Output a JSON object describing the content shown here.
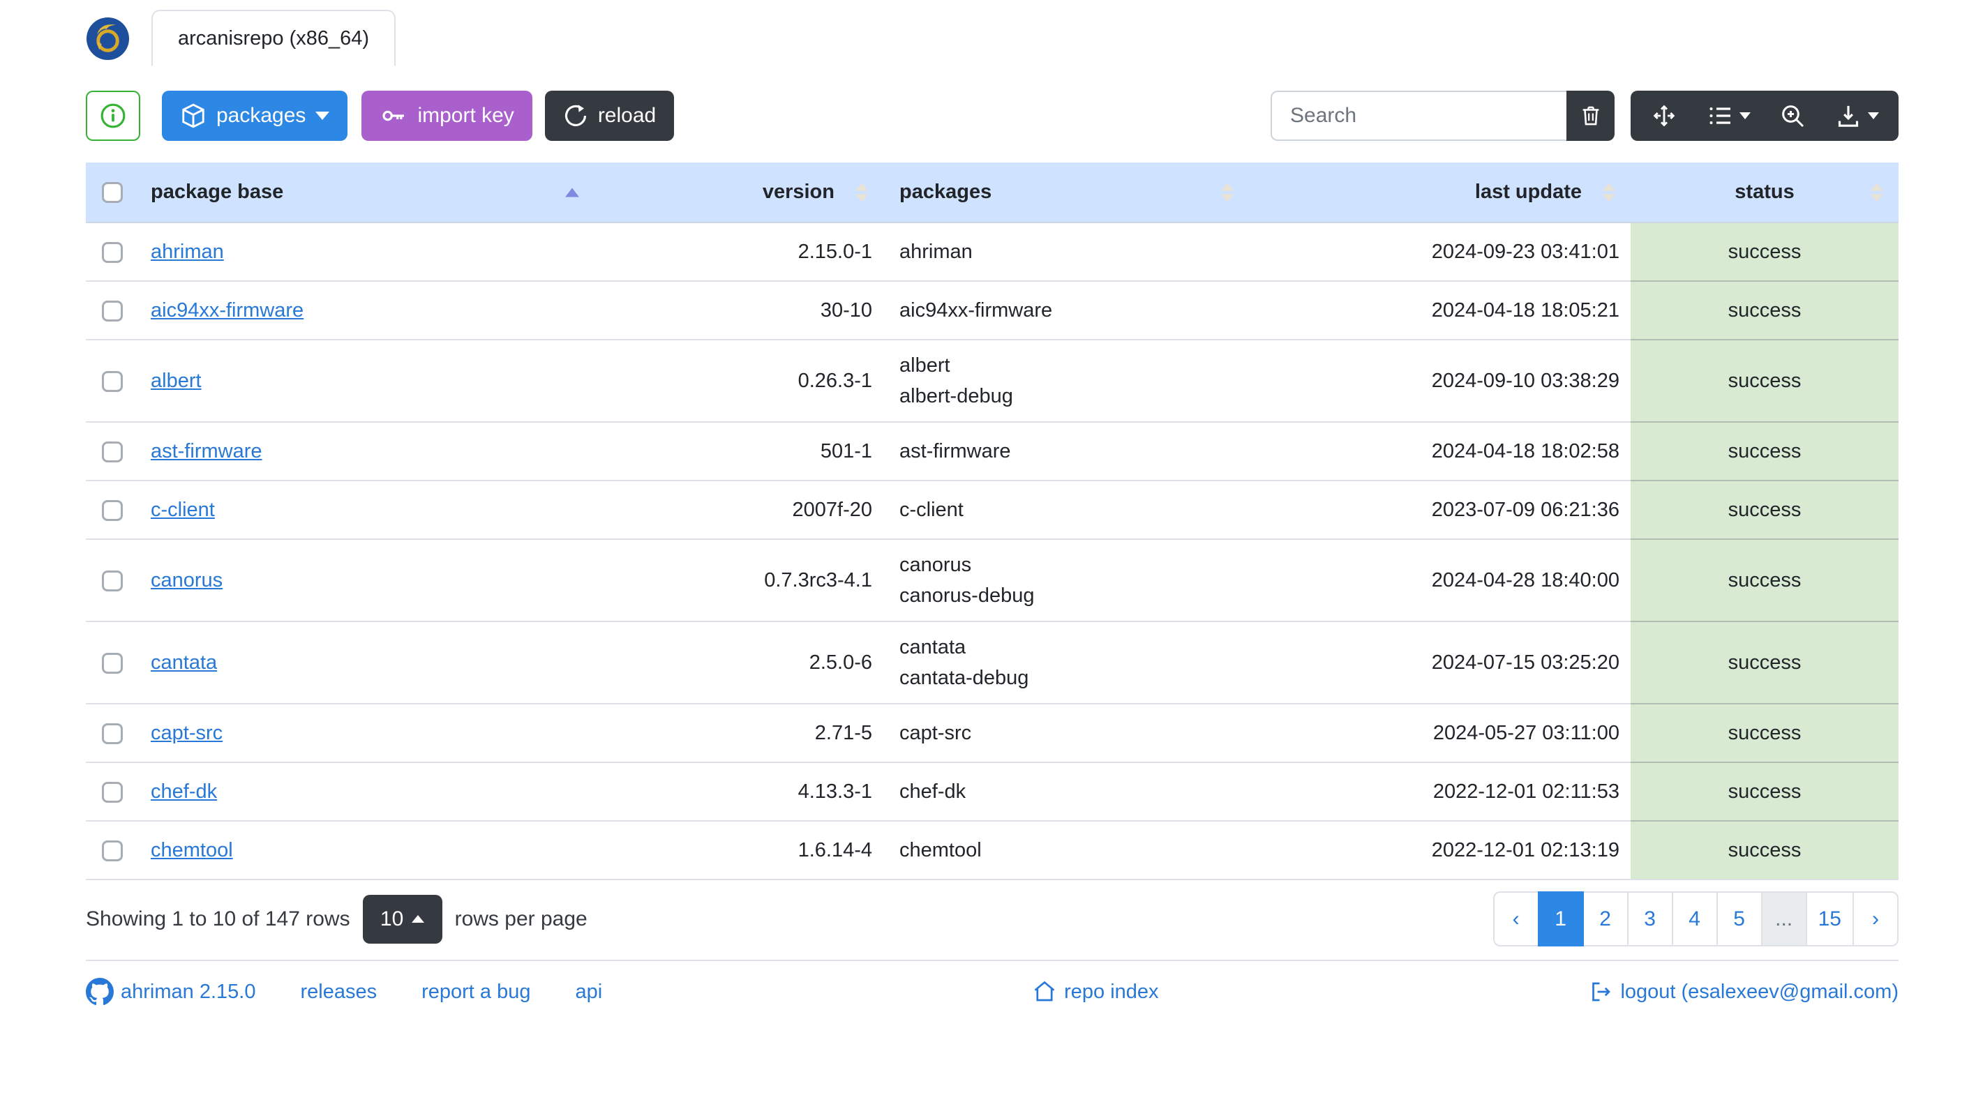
{
  "window": {
    "tab_title": "arcanisrepo (x86_64)"
  },
  "toolbar": {
    "info_button": {
      "icon": "info-icon"
    },
    "packages_button": {
      "label": "packages",
      "icon": "package-box-icon",
      "has_caret": true
    },
    "import_key_button": {
      "label": "import key",
      "icon": "key-icon"
    },
    "reload_button": {
      "label": "reload",
      "icon": "reload-icon"
    },
    "search": {
      "placeholder": "Search",
      "value": ""
    },
    "clear_button": {
      "icon": "trash-icon"
    },
    "view_buttons": [
      {
        "icon": "arrows-move-icon"
      },
      {
        "icon": "list-columns-icon",
        "has_caret": true
      },
      {
        "icon": "zoom-in-icon"
      },
      {
        "icon": "download-icon",
        "has_caret": true
      }
    ]
  },
  "table": {
    "columns": [
      {
        "key": "select",
        "label": ""
      },
      {
        "key": "base",
        "label": "package base",
        "sort": "asc"
      },
      {
        "key": "version",
        "label": "version",
        "sort": "both"
      },
      {
        "key": "packages",
        "label": "packages",
        "sort": "both"
      },
      {
        "key": "last_update",
        "label": "last update",
        "sort": "both"
      },
      {
        "key": "status",
        "label": "status",
        "sort": "both"
      }
    ],
    "rows": [
      {
        "base": "ahriman",
        "version": "2.15.0-1",
        "packages": [
          "ahriman"
        ],
        "last_update": "2024-09-23 03:41:01",
        "status": "success"
      },
      {
        "base": "aic94xx-firmware",
        "version": "30-10",
        "packages": [
          "aic94xx-firmware"
        ],
        "last_update": "2024-04-18 18:05:21",
        "status": "success"
      },
      {
        "base": "albert",
        "version": "0.26.3-1",
        "packages": [
          "albert",
          "albert-debug"
        ],
        "last_update": "2024-09-10 03:38:29",
        "status": "success"
      },
      {
        "base": "ast-firmware",
        "version": "501-1",
        "packages": [
          "ast-firmware"
        ],
        "last_update": "2024-04-18 18:02:58",
        "status": "success"
      },
      {
        "base": "c-client",
        "version": "2007f-20",
        "packages": [
          "c-client"
        ],
        "last_update": "2023-07-09 06:21:36",
        "status": "success"
      },
      {
        "base": "canorus",
        "version": "0.7.3rc3-4.1",
        "packages": [
          "canorus",
          "canorus-debug"
        ],
        "last_update": "2024-04-28 18:40:00",
        "status": "success"
      },
      {
        "base": "cantata",
        "version": "2.5.0-6",
        "packages": [
          "cantata",
          "cantata-debug"
        ],
        "last_update": "2024-07-15 03:25:20",
        "status": "success"
      },
      {
        "base": "capt-src",
        "version": "2.71-5",
        "packages": [
          "capt-src"
        ],
        "last_update": "2024-05-27 03:11:00",
        "status": "success"
      },
      {
        "base": "chef-dk",
        "version": "4.13.3-1",
        "packages": [
          "chef-dk"
        ],
        "last_update": "2022-12-01 02:11:53",
        "status": "success"
      },
      {
        "base": "chemtool",
        "version": "1.6.14-4",
        "packages": [
          "chemtool"
        ],
        "last_update": "2022-12-01 02:13:19",
        "status": "success"
      }
    ]
  },
  "pagination": {
    "summary": "Showing 1 to 10 of 147 rows",
    "page_size": "10",
    "page_size_suffix": "rows per page",
    "pages": [
      {
        "label": "‹",
        "type": "prev"
      },
      {
        "label": "1",
        "type": "page",
        "active": true
      },
      {
        "label": "2",
        "type": "page"
      },
      {
        "label": "3",
        "type": "page"
      },
      {
        "label": "4",
        "type": "page"
      },
      {
        "label": "5",
        "type": "page"
      },
      {
        "label": "...",
        "type": "ellipsis"
      },
      {
        "label": "15",
        "type": "page"
      },
      {
        "label": "›",
        "type": "next"
      }
    ]
  },
  "footer": {
    "links": [
      {
        "label": "ahriman 2.15.0",
        "icon": "github-icon"
      },
      {
        "label": "releases"
      },
      {
        "label": "report a bug"
      },
      {
        "label": "api"
      }
    ],
    "repo_index": {
      "label": "repo index",
      "icon": "home-icon"
    },
    "logout": {
      "label": "logout (esalexeev@gmail.com)",
      "icon": "logout-icon"
    }
  },
  "colors": {
    "accent_blue": "#2d87e4",
    "link_blue": "#2878d8",
    "purple": "#a960cd",
    "dark": "#343a40",
    "green_outline": "#35b335",
    "header_bg": "#cfe2ff",
    "status_success_bg": "#d9ead3",
    "sort_active": "#8188e0"
  }
}
